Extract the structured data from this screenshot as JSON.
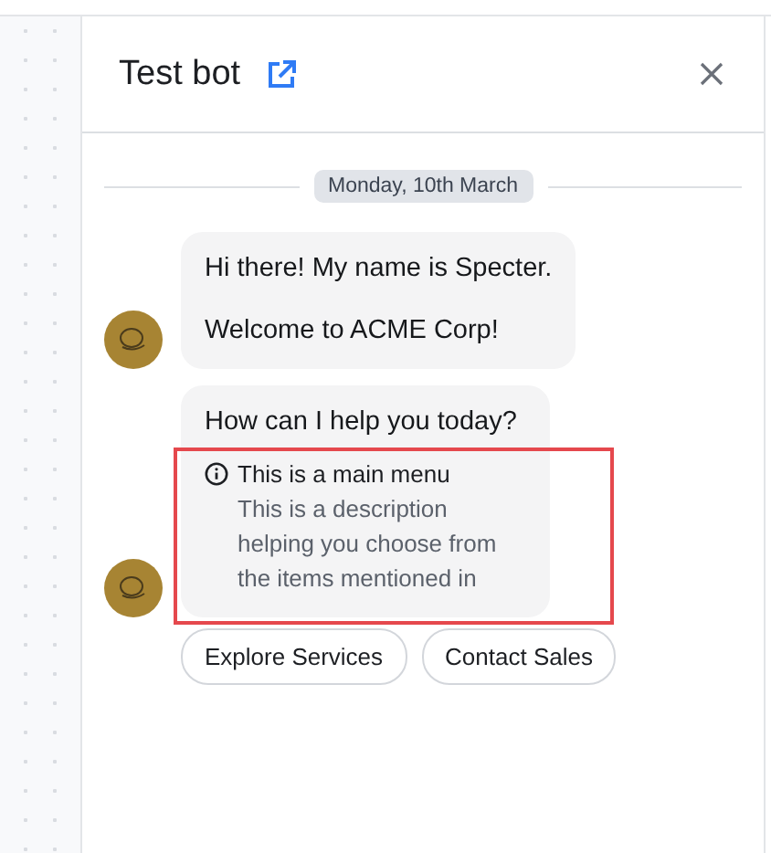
{
  "header": {
    "title": "Test bot"
  },
  "date_divider": "Monday, 10th March",
  "messages": [
    {
      "kind": "text",
      "lines": [
        "Hi there! My name is Specter.",
        "Welcome to ACME Corp!"
      ]
    },
    {
      "kind": "menu",
      "text": "How can I help you today?",
      "menu_title": "This is a main menu",
      "menu_description": "This is a description helping you choose from the items mentioned in",
      "highlighted": true
    }
  ],
  "quick_replies": [
    "Explore Services",
    "Contact Sales"
  ]
}
